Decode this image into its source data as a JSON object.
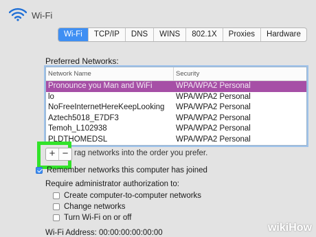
{
  "header": {
    "title": "Wi-Fi"
  },
  "tabs": [
    {
      "label": "Wi-Fi",
      "active": true
    },
    {
      "label": "TCP/IP"
    },
    {
      "label": "DNS"
    },
    {
      "label": "WINS"
    },
    {
      "label": "802.1X"
    },
    {
      "label": "Proxies"
    },
    {
      "label": "Hardware"
    }
  ],
  "preferred": {
    "label": "Preferred Networks:",
    "columns": {
      "name": "Network Name",
      "security": "Security"
    },
    "rows": [
      {
        "name": "Pronounce you Man and WiFi",
        "security": "WPA/WPA2 Personal",
        "selected": true
      },
      {
        "name": "lo",
        "security": "WPA/WPA2 Personal"
      },
      {
        "name": "NoFreeInternetHereKeepLooking",
        "security": "WPA/WPA2 Personal"
      },
      {
        "name": "Aztech5018_E7DF3",
        "security": "WPA/WPA2 Personal"
      },
      {
        "name": "Temoh_L102938",
        "security": "WPA/WPA2 Personal"
      },
      {
        "name": "PLDTHOMEDSL",
        "security": "WPA/WPA2 Personal"
      }
    ]
  },
  "buttons": {
    "add": "+",
    "remove": "−"
  },
  "drag_note": "rag networks into the order you prefer.",
  "options": {
    "remember": {
      "label": "Remember networks this computer has joined",
      "checked": true
    },
    "require_label": "Require administrator authorization to:",
    "create": {
      "label": "Create computer-to-computer networks",
      "checked": false
    },
    "change": {
      "label": "Change networks",
      "checked": false
    },
    "turn": {
      "label": "Turn Wi-Fi on or off",
      "checked": false
    }
  },
  "wifi_address": "Wi-Fi Address:  00:00:00:00:00:00",
  "watermark": "wikiHow",
  "colors": {
    "accent": "#3f8ff3",
    "selection": "#a64fa6",
    "highlight": "#32e32a"
  }
}
